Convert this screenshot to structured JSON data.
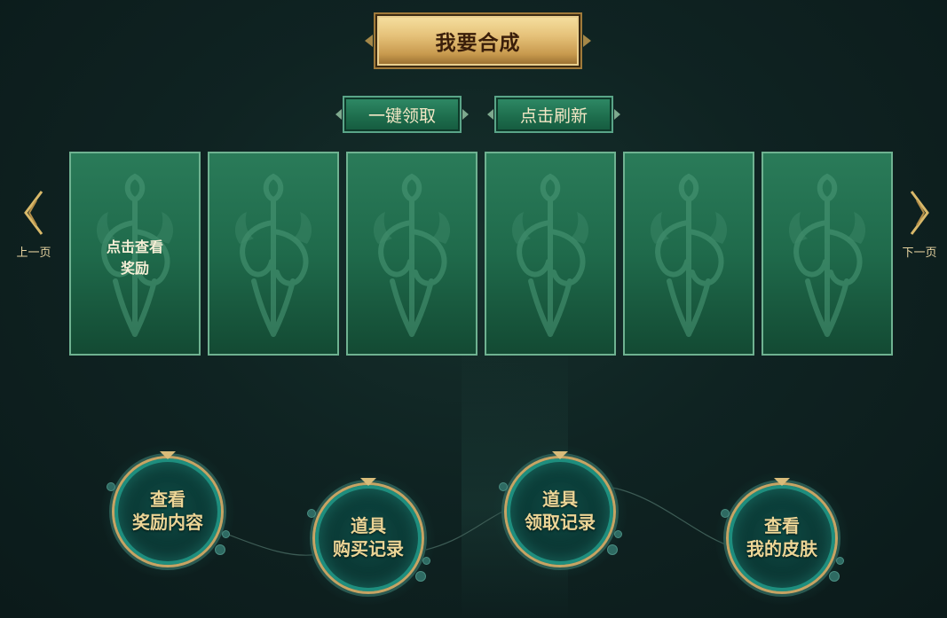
{
  "main_button": {
    "label": "我要合成"
  },
  "action_buttons": {
    "claim_all": "一键领取",
    "refresh": "点击刷新"
  },
  "cards": [
    {
      "text_line1": "点击查看",
      "text_line2": "奖励"
    },
    {
      "text_line1": "",
      "text_line2": ""
    },
    {
      "text_line1": "",
      "text_line2": ""
    },
    {
      "text_line1": "",
      "text_line2": ""
    },
    {
      "text_line1": "",
      "text_line2": ""
    },
    {
      "text_line1": "",
      "text_line2": ""
    }
  ],
  "pagination": {
    "prev_label": "上一页",
    "next_label": "下一页"
  },
  "menu": [
    {
      "line1": "查看",
      "line2": "奖励内容"
    },
    {
      "line1": "道具",
      "line2": "购买记录"
    },
    {
      "line1": "道具",
      "line2": "领取记录"
    },
    {
      "line1": "查看",
      "line2": "我的皮肤"
    }
  ],
  "colors": {
    "gold": "#c6a464",
    "card_green": "#1f6a4b",
    "text_cream": "#ecd596",
    "background": "#0f2322"
  },
  "icons": {
    "prev": "chevron-left-icon",
    "next": "chevron-right-icon",
    "card_emblem": "dragon-emblem-icon"
  }
}
